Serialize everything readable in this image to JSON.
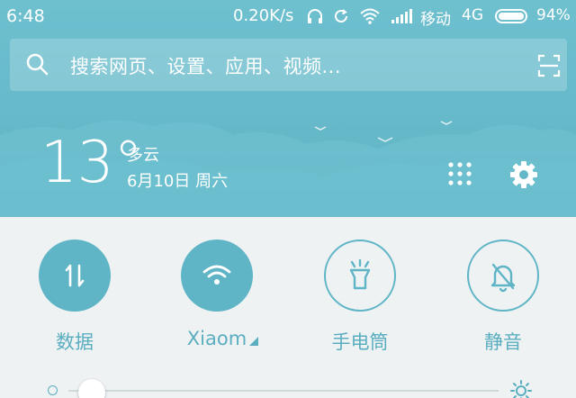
{
  "status_bar": {
    "time": "6:48",
    "net_speed": "0.20K/s",
    "carrier": "移动",
    "network_type": "4G",
    "battery_pct": "94%",
    "icons": [
      "headphones-icon",
      "sync-icon",
      "wifi-icon",
      "signal-icon",
      "battery-icon"
    ]
  },
  "search": {
    "placeholder": "搜索网页、设置、应用、视频...",
    "icon": "search-icon",
    "action_icon": "scan-icon"
  },
  "weather": {
    "temperature": "13°",
    "condition": "多云",
    "date": "6月10日 周六"
  },
  "header_actions": [
    {
      "icon": "grid-icon"
    },
    {
      "icon": "gear-icon"
    }
  ],
  "toggles": [
    {
      "label": "数据",
      "icon": "data-arrows-icon",
      "active": true
    },
    {
      "label": "Xiaom",
      "icon": "wifi-icon",
      "active": true
    },
    {
      "label": "手电筒",
      "icon": "flashlight-icon",
      "active": false
    },
    {
      "label": "静音",
      "icon": "bell-off-icon",
      "active": false
    }
  ],
  "brightness": {
    "level": 0.05,
    "low_icon": "brightness-low-icon",
    "high_icon": "brightness-high-icon"
  },
  "colors": {
    "accent": "#5fb5c6",
    "header_bg": "#66b9c9",
    "panel_bg": "#eef2f3"
  }
}
